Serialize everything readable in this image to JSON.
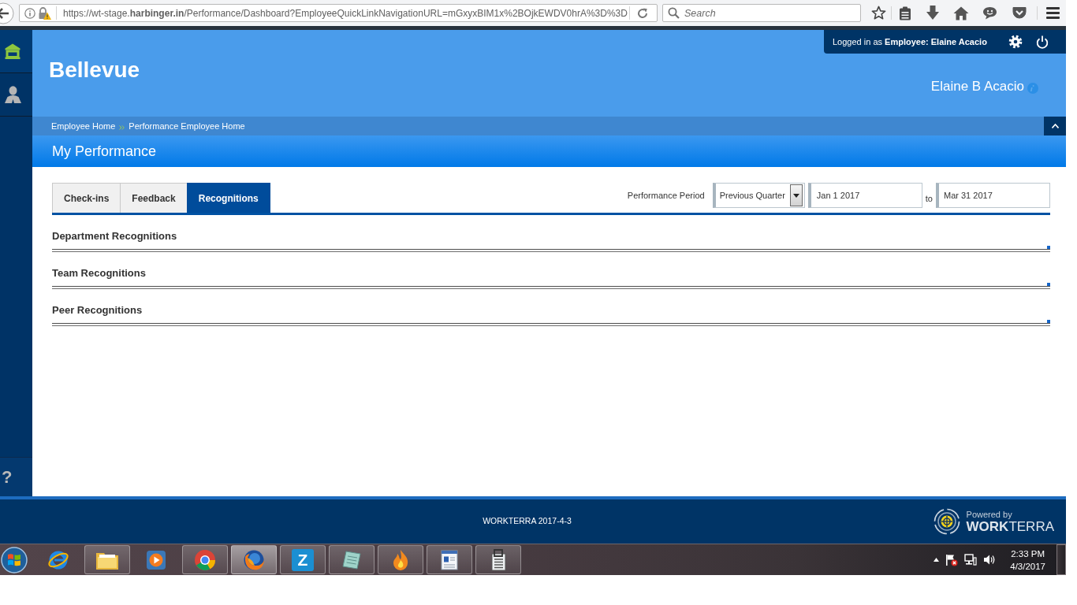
{
  "browser": {
    "url": "https://wt-stage.**harbinger.in**/Performance/Dashboard?EmployeeQuickLinkNavigationURL=mGxyxBIM1x%2BOjkEWDV0hrA%3D%3D",
    "search_placeholder": "Search"
  },
  "sidebar": {
    "items": [
      {
        "kind": "home",
        "selected": true
      },
      {
        "kind": "person",
        "selected": false
      }
    ],
    "help": "?"
  },
  "header": {
    "site_title": "Bellevue",
    "login_text": "Logged in as **Employee: Elaine Acacio**",
    "user_name": "Elaine B Acacio"
  },
  "breadcrumb": [
    "Employee Home",
    "Performance Employee Home"
  ],
  "page_title": "My Performance",
  "tabs": [
    {
      "label": "Check-ins",
      "selected": false
    },
    {
      "label": "Feedback",
      "selected": false
    },
    {
      "label": "Recognitions",
      "selected": true
    }
  ],
  "period": {
    "label": "Performance Period",
    "select_value": "Previous Quarter",
    "from": "Jan 1 2017",
    "to_label": "to",
    "to": "Mar 31 2017"
  },
  "sections": [
    {
      "title": "Department Recognitions"
    },
    {
      "title": "Team Recognitions"
    },
    {
      "title": "Peer Recognitions"
    }
  ],
  "footer": {
    "text": "WORKTERRA 2017-4-3",
    "powered_by": "Powered by",
    "brand": "**WORK**TERRA"
  },
  "taskbar": {
    "apps": [
      {
        "kind": "ie",
        "running": false,
        "selected": false
      },
      {
        "kind": "folder",
        "running": true,
        "selected": false
      },
      {
        "kind": "media",
        "running": false,
        "selected": false
      },
      {
        "kind": "chrome",
        "running": true,
        "selected": false
      },
      {
        "kind": "firefox",
        "running": true,
        "selected": true
      },
      {
        "kind": "tile",
        "label": "Z",
        "running": true,
        "selected": false
      },
      {
        "kind": "notepad",
        "running": true,
        "selected": false
      },
      {
        "kind": "flame",
        "running": true,
        "selected": false
      },
      {
        "kind": "document",
        "running": true,
        "selected": false
      },
      {
        "kind": "clipdoc",
        "running": true,
        "selected": false
      }
    ],
    "time": "2:33 PM",
    "date": "4/3/2017"
  }
}
